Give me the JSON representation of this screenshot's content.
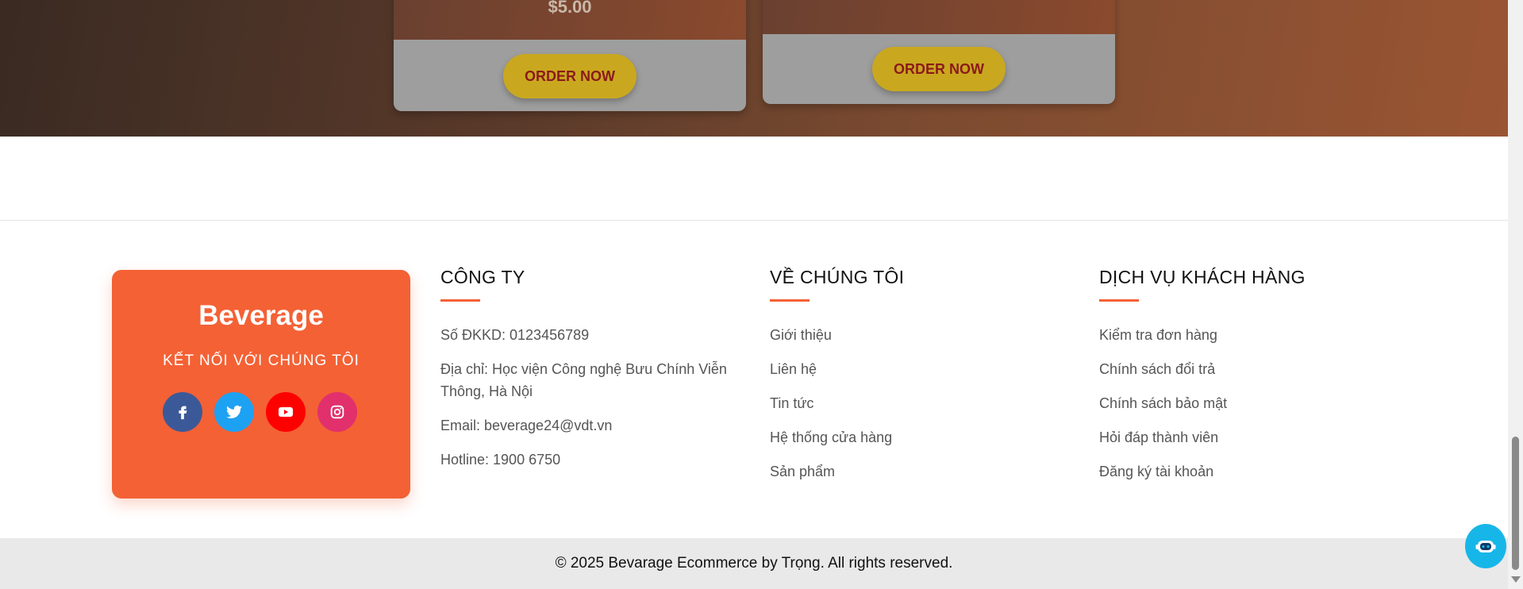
{
  "products": [
    {
      "price": "$5.00",
      "order_label": "ORDER NOW"
    },
    {
      "order_label": "ORDER NOW"
    }
  ],
  "footer": {
    "brand": {
      "title": "Beverage",
      "subtitle": "KẾT NỐI VỚI CHÚNG TÔI",
      "social": [
        "facebook-icon",
        "twitter-icon",
        "youtube-icon",
        "instagram-icon"
      ],
      "social_colors": [
        "#3b5998",
        "#1da1f2",
        "#ff0000",
        "#e1306c"
      ]
    },
    "company": {
      "heading": "CÔNG TY",
      "items": [
        "Số ĐKKD: 0123456789",
        "Địa chỉ: Học viện Công nghệ Bưu Chính Viễn",
        "Thông, Hà Nội",
        "Email: beverage24@vdt.vn",
        "Hotline: 1900 6750"
      ]
    },
    "about": {
      "heading": "VỀ CHÚNG TÔI",
      "items": [
        "Giới thiệu",
        "Liên hệ",
        "Tin tức",
        "Hệ thống cửa hàng",
        "Sản phẩm"
      ]
    },
    "service": {
      "heading": "DỊCH VỤ KHÁCH HÀNG",
      "items": [
        "Kiểm tra đơn hàng",
        "Chính sách đổi trả",
        "Chính sách bảo mật",
        "Hỏi đáp thành viên",
        "Đăng ký tài khoản"
      ]
    },
    "copyright": "© 2025 Bevarage Ecommerce by Trọng. All rights reserved."
  },
  "colors": {
    "accent": "#f46135",
    "button": "#c9a81f",
    "button_text": "#8b1a1a",
    "chat": "#17b6e8"
  }
}
